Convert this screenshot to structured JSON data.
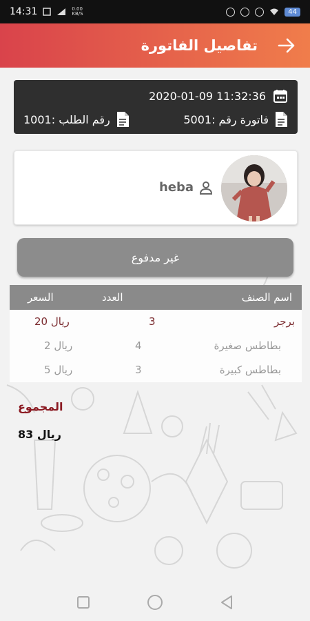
{
  "status": {
    "time": "14:31",
    "net_speed_value": "0.00",
    "net_speed_unit": "KB/S",
    "battery": "44"
  },
  "header": {
    "title": "تفاصيل الفاتورة"
  },
  "invoice": {
    "datetime": "2020-01-09 11:32:36",
    "invoice_number": "فاتورة رقم :5001",
    "order_number": "رقم الطلب :1001"
  },
  "customer": {
    "name": "heba"
  },
  "payment_status": "غير مدفوع",
  "table": {
    "headers": {
      "name": "اسم الصنف",
      "qty": "العدد",
      "price": "السعر"
    },
    "rows": [
      {
        "name": "برجر",
        "qty": "3",
        "price": "20 ريال"
      },
      {
        "name": "بطاطس صغيرة",
        "qty": "4",
        "price": "2 ريال"
      },
      {
        "name": "بطاطس كبيرة",
        "qty": "3",
        "price": "5 ريال"
      }
    ]
  },
  "total": {
    "label": "المجموع",
    "value": "83 ريال"
  },
  "colors": {
    "header_start": "#d9434b",
    "header_end": "#f07d4b",
    "info_box": "#2f2f2f",
    "unpaid_button": "#8c8c8c",
    "accent_text": "#8b1a22"
  },
  "icons": {
    "back": "arrow-right-icon",
    "calendar": "calendar-icon",
    "document": "document-icon",
    "user": "person-icon"
  }
}
